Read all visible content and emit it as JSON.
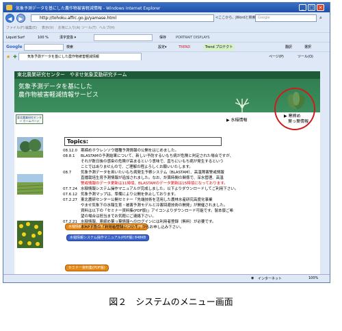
{
  "window": {
    "title": "気象予測データを基にした農作物被害軽減情報 - Windows Internet Explorer"
  },
  "address": {
    "url": "http://tohoku.affrc.go.jp/yamase.html",
    "status_text": "<ここから、JWordと検索>",
    "search_placeholder": "Google"
  },
  "menu": {
    "items": [
      "ファイル(F)",
      "編集(E)",
      "表示(V)",
      "お気に入り(A)",
      "ツール(T)",
      "ヘルプ(H)"
    ]
  },
  "toolbar1": {
    "liquid": "Liquid Surf",
    "zoom": "100 %",
    "kanji": "漢字変換 ▾",
    "save": "保存",
    "portrait": "PORTRAIT DISPLAYS"
  },
  "toolbar2": {
    "brand": "Google",
    "search": "検索",
    "settings": "設定▾",
    "trend": "TREND",
    "trend_project": "Trend プロテクト",
    "translate": "翻訳",
    "options": "選択"
  },
  "tab": {
    "label": "気象予測データを基にした農作物被害軽減情報",
    "page_menu": "ページ(P)",
    "tools_menu": "ツール(O)"
  },
  "banner": {
    "org": "東北農業研究センター　やませ気象変動研究チーム",
    "line1": "気象予測データを基にした",
    "line2": "農作物被害軽減情報サービス"
  },
  "nav": {
    "home": "東北農業研究センター ホームページ",
    "rice": "▶ 水稲情報",
    "ryokumame_1": "▶ 寒締め",
    "ryokumame_2": "葉っ葉情報"
  },
  "topics": {
    "heading": "Topics:"
  },
  "news": [
    {
      "date": "08.12.0",
      "text": "寒締めホウレンソウ播種予測情報の公開をはじめました。",
      "cls": ""
    },
    {
      "date": "08.8.1",
      "text": "BLASTAMの予測結果について、新しい予防するいもち病が危険と判定された場合ですが、",
      "cls": ""
    },
    {
      "date": "",
      "text": "それが数日後の感染の危険が高まるという意味で、直ちにいもち病が発生するという",
      "cls": "indent"
    },
    {
      "date": "",
      "text": "ことではありませんので、ご理解の程よろしくお願いいたします。",
      "cls": "indent"
    },
    {
      "date": "08.7",
      "text": "気象予測データを用いたいもち病発生予察システム（BLASTAM）、高温障害警戒情報",
      "cls": ""
    },
    {
      "date": "",
      "text": "直播栽培生育予測情報が追加されました。なお、計算時間の関係で、深水管理、高温",
      "cls": "indent"
    },
    {
      "date": "",
      "text": "警戒情報のデータ更新は11時頃、BLASTAMのデータ更新は15時頃になっております。",
      "cls": "indent red"
    },
    {
      "date": "07.7.24",
      "text": "水稲情報システム操作マニュアルが完成しました。以下よりダウンロードしてご利用下さい。",
      "cls": ""
    },
    {
      "date": "07.6.12",
      "text": "気象予測マップは、準備により公開を休止しております。",
      "cls": ""
    },
    {
      "date": "07.2.27",
      "text": "東北農研センター公開セミナー「先端技術を活用した農林水産研究高度化事業",
      "cls": ""
    },
    {
      "date": "",
      "text": "やませ気象下の水稲生育・被害予測モデルと冷害回避技術の開発」が開催されました。",
      "cls": "indent"
    },
    {
      "date": "",
      "text": "資料は以下の「セミナー資料集(PDF版)」アイコンよりダウンロード可能です。製本版ご希",
      "cls": "indent"
    },
    {
      "date": "",
      "text": "望の場合は担当までお気軽にご連絡下さい。",
      "cls": "indent"
    },
    {
      "date": "07.2.21",
      "text": "水稲情報、寒締め葉っ葉情報へのログインには利用者登録（無料）が必要です。",
      "cls": ""
    },
    {
      "date": "",
      "text": "本HP下段の「利用者登録について」からお申し込み下さい。",
      "cls": "indent"
    }
  ],
  "downloads": {
    "manual_pdf": "水稲情報システム操作マニュアル(PDF版) 3.3MB",
    "manual_pdf2": "水稲情報システム操作マニュアル(PDF版) 848KB",
    "seminar": "セミナー資料集(PDF版)"
  },
  "statusbar": {
    "zone": "インターネット",
    "zoom": "100%"
  },
  "caption": "図２　システムのメニュー画面"
}
